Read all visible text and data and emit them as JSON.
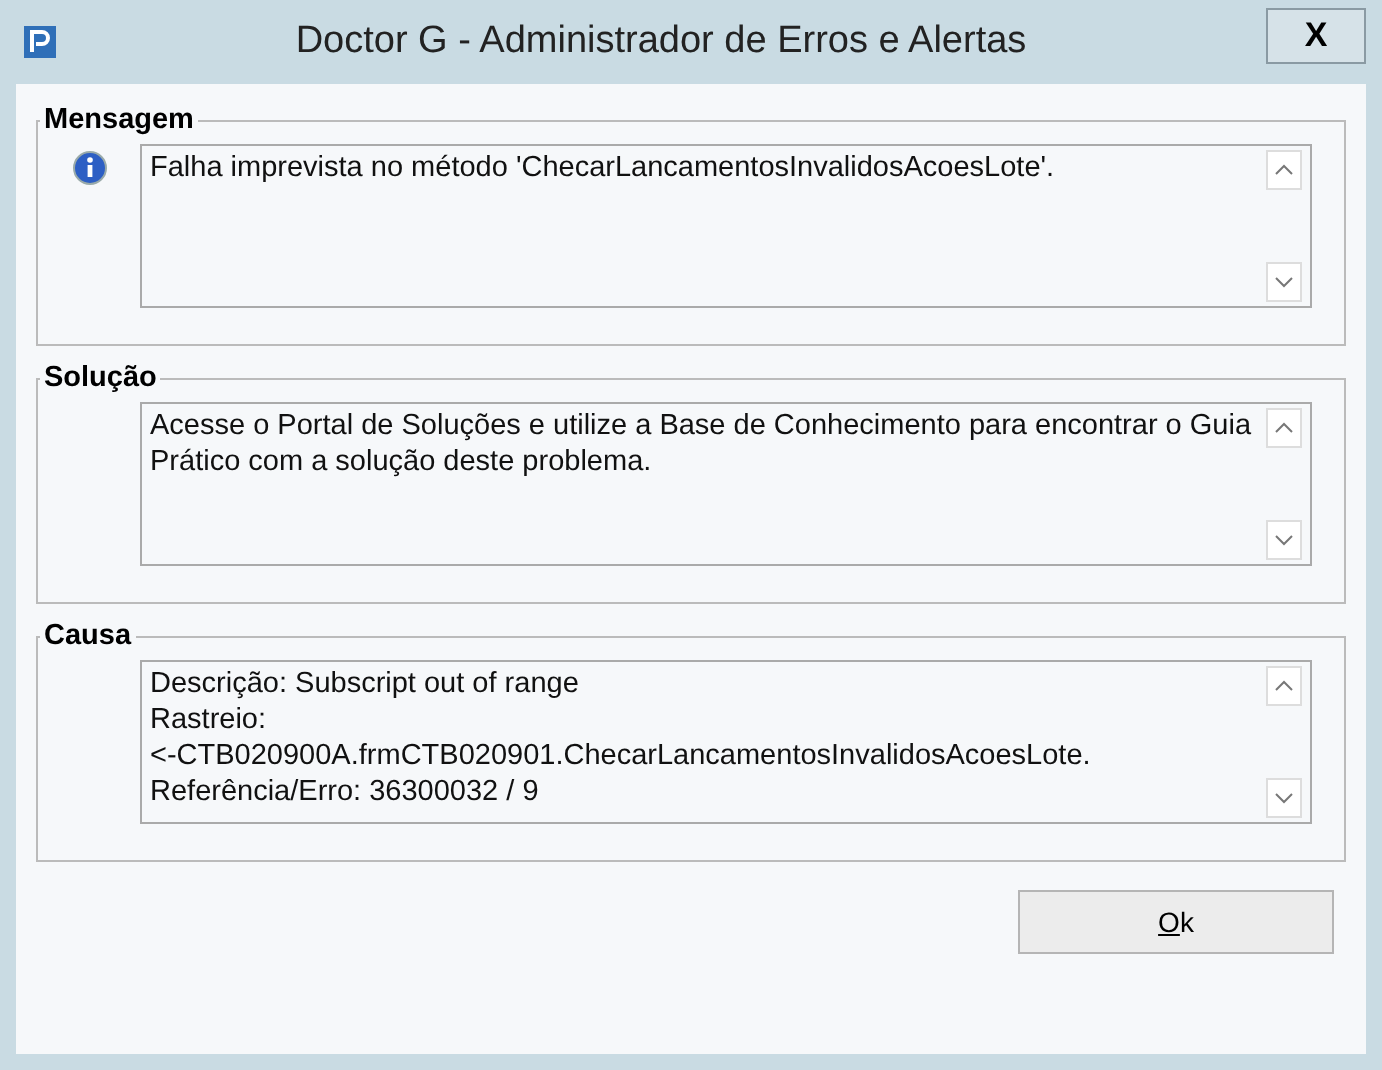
{
  "window": {
    "title": "Doctor G - Administrador de Erros e Alertas",
    "close": "X"
  },
  "sections": [
    {
      "title": "Mensagem",
      "kind": "info",
      "lines": [
        "Falha imprevista no método 'ChecarLancamentosInvalidosAcoesLote'."
      ]
    },
    {
      "title": "Solução",
      "kind": "plain",
      "lines": [
        "Acesse o Portal de Soluções e utilize a Base de Conhecimento para encontrar o Guia Prático com a solução deste problema."
      ]
    },
    {
      "title": "Causa",
      "kind": "plain",
      "lines": [
        "Descrição: Subscript out of range",
        "Rastreio:",
        "<-CTB020900A.frmCTB020901.ChecarLancamentosInvalidosAcoesLote.",
        "Referência/Erro: 36300032 / 9"
      ]
    }
  ],
  "ok_button": "Ok"
}
